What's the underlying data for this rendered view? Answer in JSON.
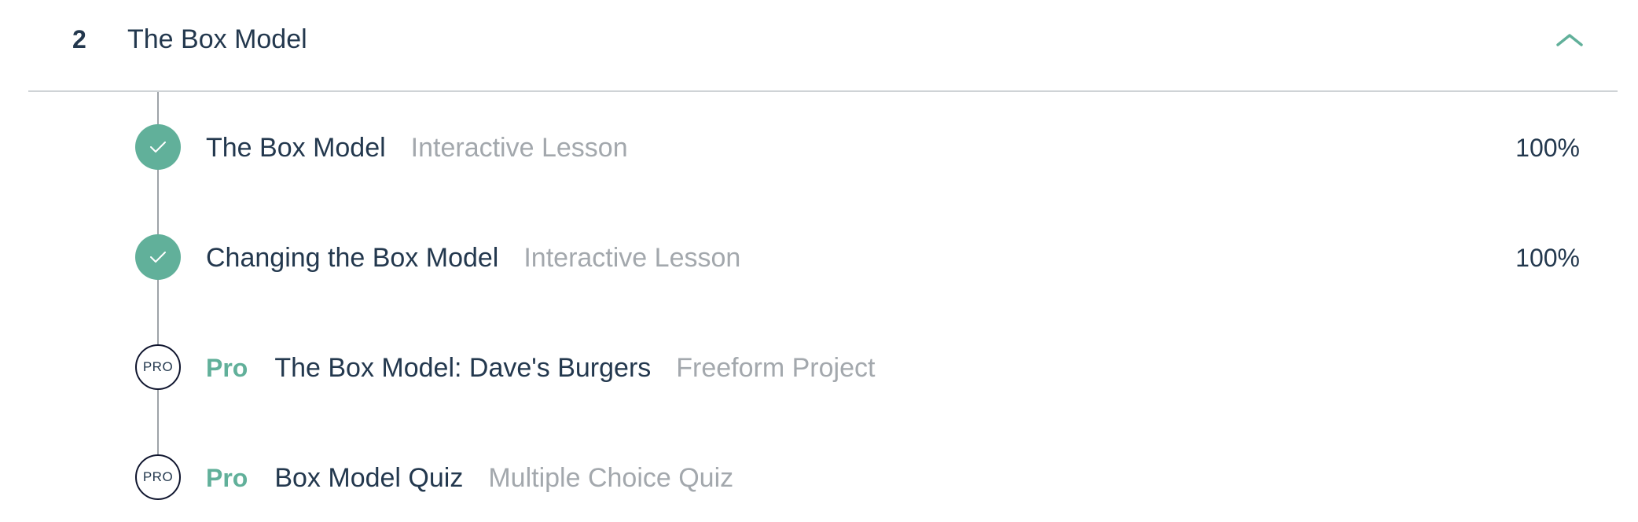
{
  "module": {
    "number": "2",
    "title": "The Box Model",
    "toggle_icon": "chevron-up-icon",
    "accent_color": "#61b09a"
  },
  "lessons": [
    {
      "title": "The Box Model",
      "type": "Interactive Lesson",
      "status": "complete",
      "status_icon": "check-icon",
      "progress": "100%"
    },
    {
      "title": "Changing the Box Model",
      "type": "Interactive Lesson",
      "status": "complete",
      "status_icon": "check-icon",
      "progress": "100%"
    },
    {
      "title": "The Box Model: Dave's Burgers",
      "type": "Freeform Project",
      "status": "pro",
      "badge": "PRO",
      "pro_label": "Pro"
    },
    {
      "title": "Box Model Quiz",
      "type": "Multiple Choice Quiz",
      "status": "pro",
      "badge": "PRO",
      "pro_label": "Pro"
    }
  ]
}
